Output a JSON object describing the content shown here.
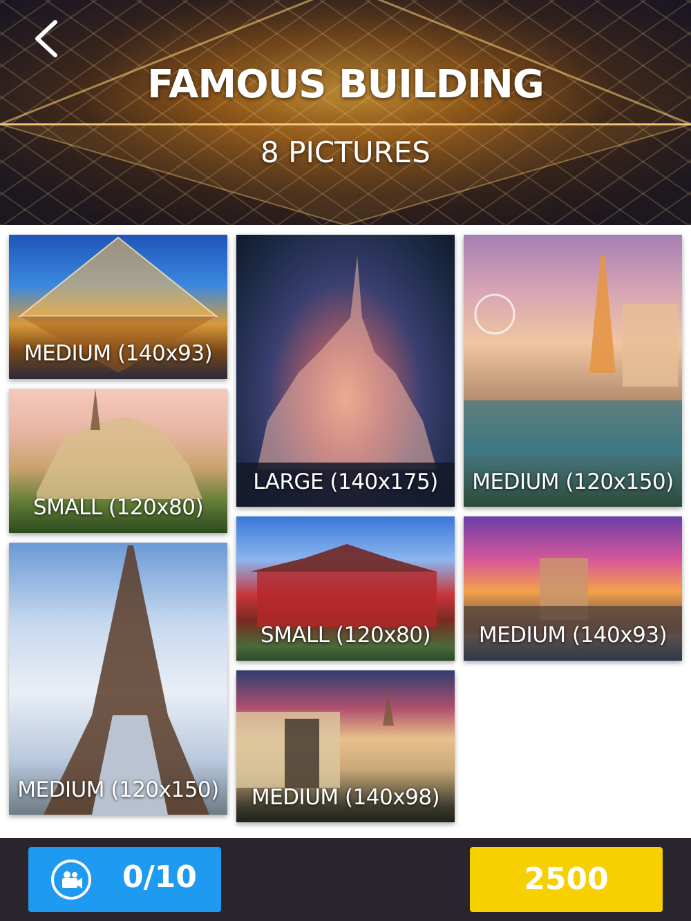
{
  "header": {
    "title": "FAMOUS BUILDING",
    "subtitle": "8 PICTURES",
    "back_icon": "chevron-left-icon"
  },
  "tiles": [
    {
      "label": "MEDIUM (140x93)",
      "subject": "Louvre pyramid"
    },
    {
      "label": "SMALL (120x80)",
      "subject": "Notre-Dame cathedral"
    },
    {
      "label": "MEDIUM (120x150)",
      "subject": "Eiffel Tower"
    },
    {
      "label": "LARGE (140x175)",
      "subject": "Fairytale castle at night"
    },
    {
      "label": "SMALL (120x80)",
      "subject": "Chinese temple"
    },
    {
      "label": "MEDIUM (140x98)",
      "subject": "Parliament with statue"
    },
    {
      "label": "MEDIUM (120x150)",
      "subject": "Las Vegas Eiffel replica"
    },
    {
      "label": "MEDIUM (140x93)",
      "subject": "Bridge at sunset"
    }
  ],
  "footer": {
    "video_counter": "0/10",
    "video_icon": "video-camera-icon",
    "coins": "2500"
  },
  "colors": {
    "video_button": "#1e9bf0",
    "coin_button": "#f6d000",
    "footer_bg": "#2a252d"
  }
}
